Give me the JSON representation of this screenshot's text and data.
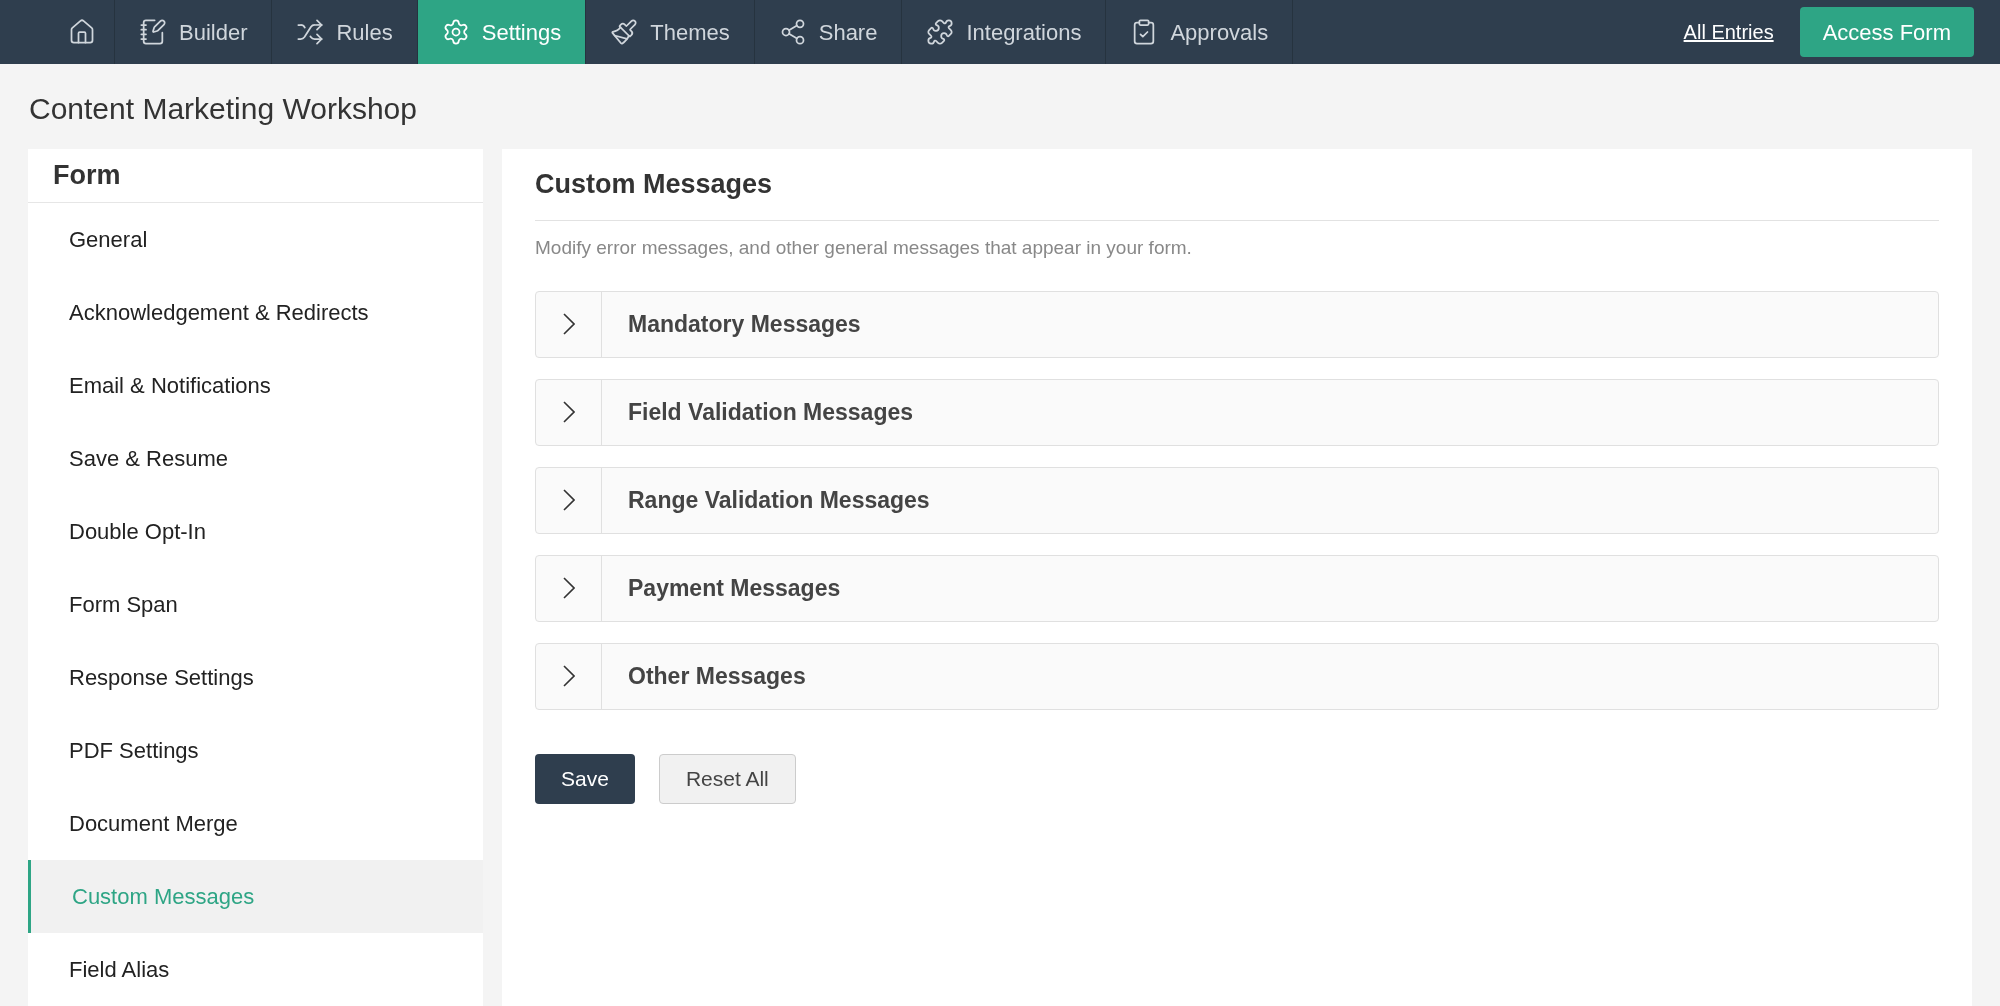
{
  "nav": {
    "tabs": [
      {
        "kind": "home",
        "selected": false
      },
      {
        "kind": "builder",
        "label": "Builder",
        "selected": false
      },
      {
        "kind": "rules",
        "label": "Rules",
        "selected": false
      },
      {
        "kind": "settings",
        "label": "Settings",
        "selected": true
      },
      {
        "kind": "themes",
        "label": "Themes",
        "selected": false
      },
      {
        "kind": "share",
        "label": "Share",
        "selected": false
      },
      {
        "kind": "integrations",
        "label": "Integrations",
        "selected": false
      },
      {
        "kind": "approvals",
        "label": "Approvals",
        "selected": false
      }
    ],
    "link": "All Entries",
    "button": "Access Form"
  },
  "page_title": "Content Marketing Workshop",
  "sidebar": {
    "heading": "Form",
    "items": [
      {
        "label": "General",
        "selected": false
      },
      {
        "label": "Acknowledgement & Redirects",
        "selected": false
      },
      {
        "label": "Email & Notifications",
        "selected": false
      },
      {
        "label": "Save & Resume",
        "selected": false
      },
      {
        "label": "Double Opt-In",
        "selected": false
      },
      {
        "label": "Form Span",
        "selected": false
      },
      {
        "label": "Response Settings",
        "selected": false
      },
      {
        "label": "PDF Settings",
        "selected": false
      },
      {
        "label": "Document Merge",
        "selected": false
      },
      {
        "label": "Custom Messages",
        "selected": true
      },
      {
        "label": "Field Alias",
        "selected": false
      }
    ]
  },
  "main": {
    "title": "Custom Messages",
    "description": "Modify error messages, and other general messages that appear in your form.",
    "sections": [
      {
        "label": "Mandatory Messages",
        "expanded": false
      },
      {
        "label": "Field Validation Messages",
        "expanded": false
      },
      {
        "label": "Range Validation Messages",
        "expanded": false
      },
      {
        "label": "Payment Messages",
        "expanded": false
      },
      {
        "label": "Other Messages",
        "expanded": false
      }
    ],
    "buttons": [
      {
        "kind": "primary",
        "label": "Save"
      },
      {
        "kind": "secondary",
        "label": "Reset All"
      }
    ]
  }
}
